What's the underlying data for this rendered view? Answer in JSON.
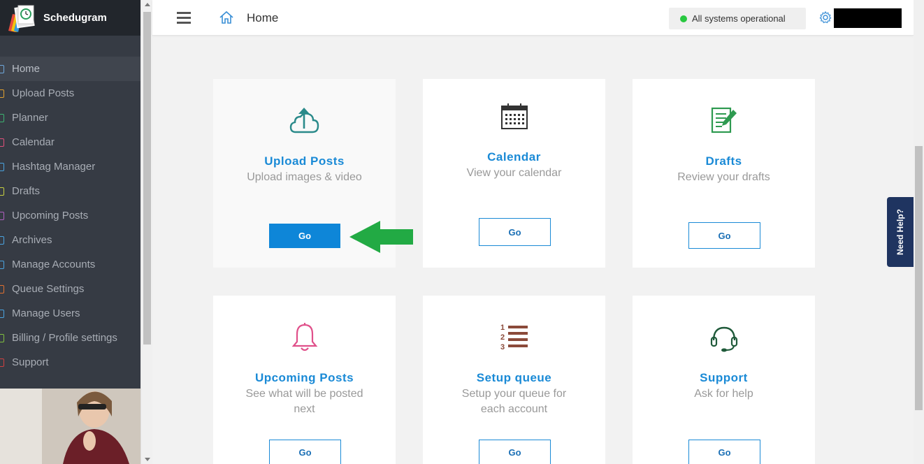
{
  "app": {
    "name": "Schedugram"
  },
  "sidebar": {
    "items": [
      {
        "label": "Home",
        "color": "#6fa8dc",
        "active": true
      },
      {
        "label": "Upload Posts",
        "color": "#e0a030"
      },
      {
        "label": "Planner",
        "color": "#3cb371"
      },
      {
        "label": "Calendar",
        "color": "#e0507a"
      },
      {
        "label": "Hashtag Manager",
        "color": "#4aa3df"
      },
      {
        "label": "Drafts",
        "color": "#c8d040"
      },
      {
        "label": "Upcoming Posts",
        "color": "#b060c0"
      },
      {
        "label": "Archives",
        "color": "#4aa3df"
      },
      {
        "label": "Manage Accounts",
        "color": "#4aa3df"
      },
      {
        "label": "Queue Settings",
        "color": "#e07030"
      },
      {
        "label": "Manage Users",
        "color": "#4aa3df"
      },
      {
        "label": "Billing / Profile settings",
        "color": "#7fbf3f"
      },
      {
        "label": "Support",
        "color": "#d04040"
      }
    ]
  },
  "header": {
    "title": "Home",
    "status": "All systems operational",
    "status_color": "#28c840"
  },
  "cards": [
    {
      "title": "Upload Posts",
      "subtitle": "Upload images & video",
      "button": "Go",
      "icon": "cloud-upload-icon",
      "icon_color": "#2a8a8a"
    },
    {
      "title": "Calendar",
      "subtitle": "View your calendar",
      "button": "Go",
      "icon": "calendar-icon",
      "icon_color": "#333333"
    },
    {
      "title": "Drafts",
      "subtitle": "Review your drafts",
      "button": "Go",
      "icon": "drafts-icon",
      "icon_color": "#2e9a50"
    },
    {
      "title": "Upcoming Posts",
      "subtitle": "See what will be posted next",
      "button": "Go",
      "icon": "bell-icon",
      "icon_color": "#e0508a"
    },
    {
      "title": "Setup queue",
      "subtitle": "Setup your queue for each account",
      "button": "Go",
      "icon": "numbered-list-icon",
      "icon_color": "#8b4a3a"
    },
    {
      "title": "Support",
      "subtitle": "Ask for help",
      "button": "Go",
      "icon": "headset-icon",
      "icon_color": "#1f5a3a"
    }
  ],
  "help_tab": {
    "label": "Need Help?"
  },
  "colors": {
    "accent": "#1a8ad6",
    "sidebar_bg": "#363b44",
    "arrow": "#22aa44"
  }
}
